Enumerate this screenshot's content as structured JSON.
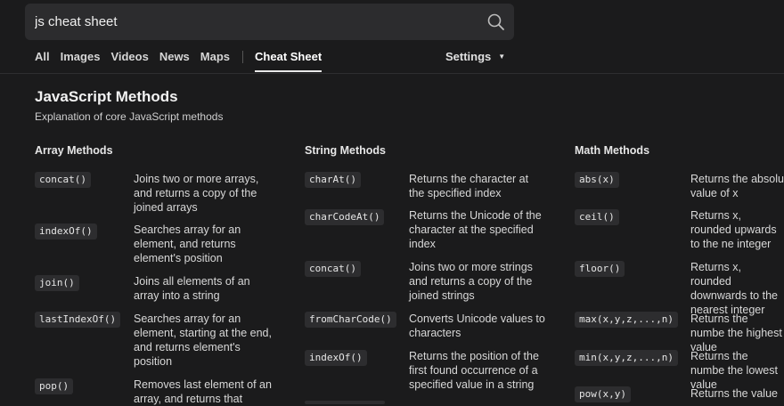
{
  "search": {
    "value": "js cheat sheet",
    "icon": "search-icon"
  },
  "nav": {
    "items": [
      "All",
      "Images",
      "Videos",
      "News",
      "Maps"
    ],
    "active": "Cheat Sheet",
    "settings": "Settings",
    "settings_caret": "▼"
  },
  "page": {
    "title": "JavaScript Methods",
    "subtitle": "Explanation of core JavaScript methods"
  },
  "columns": [
    {
      "title": "Array Methods",
      "rows": [
        {
          "code": "concat()",
          "desc": "Joins two or more arrays, and returns a copy of the joined arrays"
        },
        {
          "code": "indexOf()",
          "desc": "Searches array for an element, and returns element's position"
        },
        {
          "code": "join()",
          "desc": "Joins all elements of an array into a string"
        },
        {
          "code": "lastIndexOf()",
          "desc": "Searches array for an element, starting at the end, and returns element's position"
        },
        {
          "code": "pop()",
          "desc": "Removes last element of an array, and returns that"
        }
      ]
    },
    {
      "title": "String Methods",
      "rows": [
        {
          "code": "charAt()",
          "desc": "Returns the character at the specified index"
        },
        {
          "code": "charCodeAt()",
          "desc": "Returns the Unicode of the character at the specified index"
        },
        {
          "code": "concat()",
          "desc": "Joins two or more strings and returns a copy of the joined strings"
        },
        {
          "code": "fromCharCode()",
          "desc": "Converts Unicode values to characters"
        },
        {
          "code": "indexOf()",
          "desc": "Returns the position of the first found occurrence of a specified value in a string"
        }
      ]
    },
    {
      "title": "Math Methods",
      "rows": [
        {
          "code": "abs(x)",
          "desc": "Returns the absolu value of x"
        },
        {
          "code": "ceil()",
          "desc": "Returns x, rounded upwards to the ne integer"
        },
        {
          "code": "floor()",
          "desc": "Returns x, rounded downwards to the nearest integer"
        },
        {
          "code": "max(x,y,z,...,n)",
          "desc": "Returns the numbe the highest value"
        },
        {
          "code": "min(x,y,z,...,n)",
          "desc": "Returns the numbe the lowest value"
        },
        {
          "code": "pow(x,y)",
          "desc": "Returns the value"
        }
      ]
    }
  ]
}
